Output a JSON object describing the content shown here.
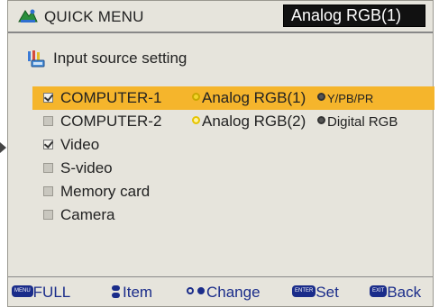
{
  "header": {
    "title": "QUICK MENU",
    "current_source": "Analog RGB(1)"
  },
  "section": {
    "title": "Input source setting"
  },
  "sources": [
    {
      "label": "COMPUTER-1",
      "checked": true,
      "selected": true,
      "options": [
        {
          "label": "Analog RGB(1)",
          "state": "on"
        },
        {
          "label": "Y/PB/PR",
          "state": "off"
        }
      ]
    },
    {
      "label": "COMPUTER-2",
      "checked": false,
      "selected": false,
      "options": [
        {
          "label": "Analog RGB(2)",
          "state": "on"
        },
        {
          "label": "Digital RGB",
          "state": "off"
        }
      ]
    },
    {
      "label": "Video",
      "checked": true,
      "selected": false
    },
    {
      "label": "S-video",
      "checked": false,
      "selected": false
    },
    {
      "label": "Memory card",
      "checked": false,
      "selected": false
    },
    {
      "label": "Camera",
      "checked": false,
      "selected": false
    }
  ],
  "footer": {
    "full": {
      "key": "MENU",
      "label": "FULL"
    },
    "item": {
      "label": "Item"
    },
    "change": {
      "label": "Change"
    },
    "set": {
      "key": "ENTER",
      "label": "Set"
    },
    "back": {
      "key": "EXIT",
      "label": "Back"
    }
  },
  "colors": {
    "highlight": "#f5b52c",
    "footer_text": "#1a2c8a",
    "panel": "#e6e4dc"
  }
}
